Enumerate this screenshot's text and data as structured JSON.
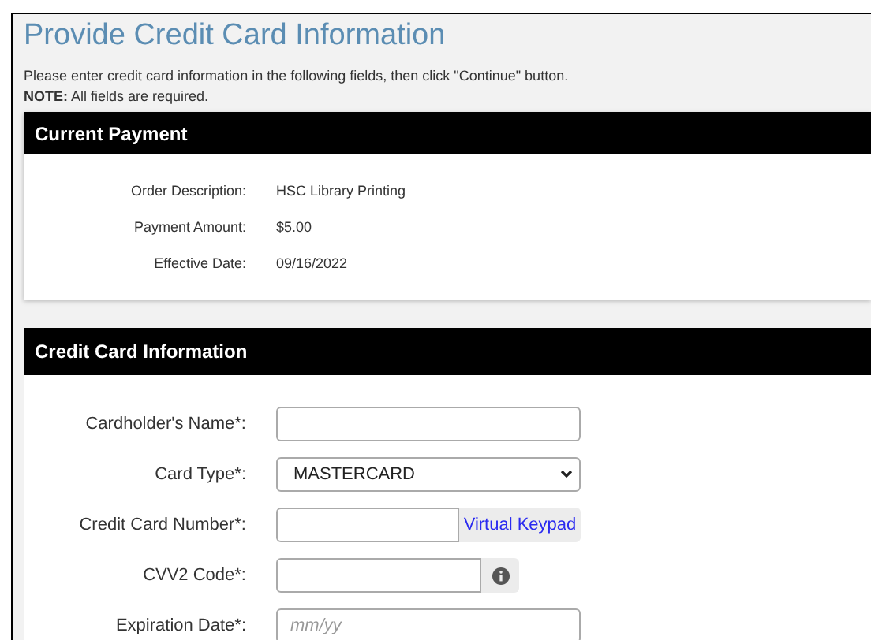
{
  "title": "Provide Credit Card Information",
  "instructions": "Please enter credit card information in the following fields, then click \"Continue\" button.",
  "note": "**NOTE:** All fields are required.",
  "current_payment": {
    "heading": "Current Payment",
    "rows": [
      {
        "label": "Order Description:",
        "value": "HSC Library Printing"
      },
      {
        "label": "Payment Amount:",
        "value": "$5.00"
      },
      {
        "label": "Effective Date:",
        "value": "09/16/2022"
      }
    ]
  },
  "credit_card": {
    "heading": "Credit Card Information",
    "fields": [
      {
        "kind": "text",
        "label": "Cardholder's Name*:"
      },
      {
        "kind": "select",
        "label": "Card Type*:",
        "value": "MASTERCARD"
      },
      {
        "kind": "button",
        "label": "Credit Card Number*:",
        "button": "Virtual Keypad"
      },
      {
        "kind": "info",
        "label": "CVV2 Code*:"
      },
      {
        "kind": "text",
        "label": "Expiration Date*:",
        "placeholder": "mm/yy"
      }
    ]
  }
}
